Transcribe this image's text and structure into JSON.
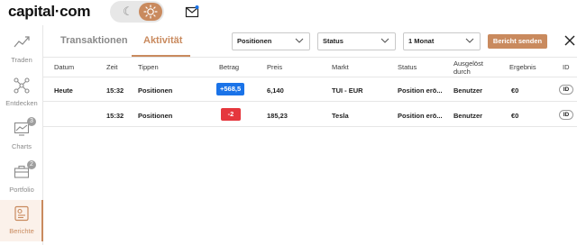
{
  "header": {
    "logo": "capital·com",
    "theme_toggle": {
      "options": [
        "dark",
        "light"
      ],
      "selected": "light"
    },
    "mail_icon": "mail-icon"
  },
  "sidebar": {
    "items": [
      {
        "label": "Traden",
        "icon": "trend-line-icon"
      },
      {
        "label": "Entdecken",
        "icon": "network-nodes-icon"
      },
      {
        "label": "Charts",
        "icon": "chart-icon",
        "badge": "3"
      },
      {
        "label": "Portfolio",
        "icon": "briefcase-icon",
        "badge": "2"
      },
      {
        "label": "Berichte",
        "icon": "report-icon",
        "active": true
      }
    ]
  },
  "tabs": [
    {
      "label": "Transaktionen",
      "active": false
    },
    {
      "label": "Aktivität",
      "active": true
    }
  ],
  "filters": {
    "type": "Positionen",
    "status": "Status",
    "period": "1 Monat"
  },
  "send_report_button": "Bericht senden",
  "table": {
    "columns": [
      "Datum",
      "Zeit",
      "Tippen",
      "Betrag",
      "Preis",
      "Markt",
      "Status",
      "Ausgelöst durch",
      "Ergebnis",
      "ID"
    ],
    "rows": [
      {
        "date": "Heute",
        "time": "15:32",
        "type": "Positionen",
        "amount": "+568,5",
        "amount_color": "#1a73e8",
        "price": "6,140",
        "market": "TUI - EUR",
        "status": "Position erö...",
        "triggered_by": "Benutzer",
        "result": "€0",
        "id": "ID"
      },
      {
        "date": "",
        "time": "15:32",
        "type": "Positionen",
        "amount": "-2",
        "amount_color": "#e5373d",
        "price": "185,23",
        "market": "Tesla",
        "status": "Position erö...",
        "triggered_by": "Benutzer",
        "result": "€0",
        "id": "ID"
      }
    ]
  },
  "colors": {
    "accent": "#c98a5e",
    "positive": "#1a73e8",
    "negative": "#e5373d"
  }
}
